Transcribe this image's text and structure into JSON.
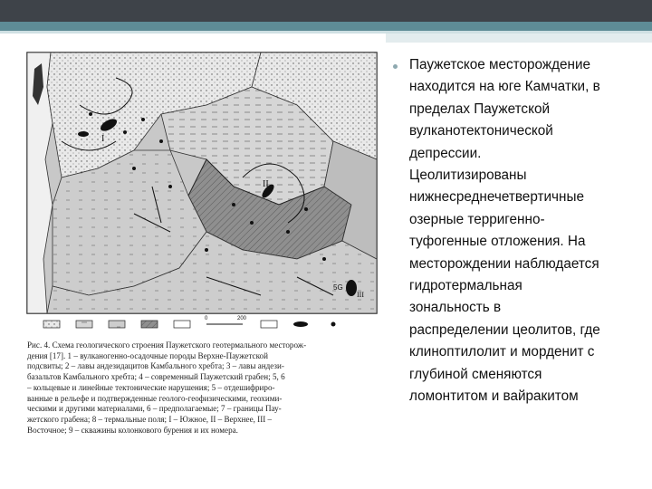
{
  "slide": {
    "bullet_text": "Паужетское месторождение\nнаходится на юге Камчатки, в\nпределах Паужетской\nвулканотектонической\nдепрессии.\nЦеолитизированы\nнижнесреднечетвертичные\nозерные терригенно-\nтуфогенные отложения. На\nместорождении наблюдается\nгидротермальная\nзональность в\nраспределении цеолитов, где\nклиноптилолит и морденит с\nглубиной сменяются\nломонтитом и вайракитом"
  },
  "figure": {
    "caption": "Рис. 4. Схема геологического строения Паужетского геотермального месторож-\nдения [17]. 1 – вулканогенно-осадочные породы Верхне-Паужетской\nподсвиты; 2 – лавы андезидацитов Камбального хребта; 3 – лавы андези-\nбазальтов Камбального хребта; 4 – современный Паужетский грабен; 5, 6\n– кольцевые и линейные тектонические нарушения; 5 – отдешифриро-\nванные в рельефе и подтвержденные геолого-геофизическими, геохими-\nческими и другими материалами, 6 – предполагаемые; 7 – границы Пау-\nжетского грабена; 8 – термальные поля; I – Южное, II – Верхнее, III –\nВосточное; 9 – скважины колонкового бурения и их номера.",
    "map_labels": {
      "roman_1": "I",
      "roman_2": "II",
      "roman_3": "III",
      "well_label": "5G",
      "scale_start": "0",
      "scale_end": "200"
    },
    "legend_numbers": [
      "1",
      "2",
      "3",
      "4",
      "5",
      "6",
      "7",
      "8",
      "9"
    ]
  },
  "theme": {
    "top_bar": "#3e4349",
    "accent": "#5e8c96",
    "bullet": "#8ea9b0"
  }
}
